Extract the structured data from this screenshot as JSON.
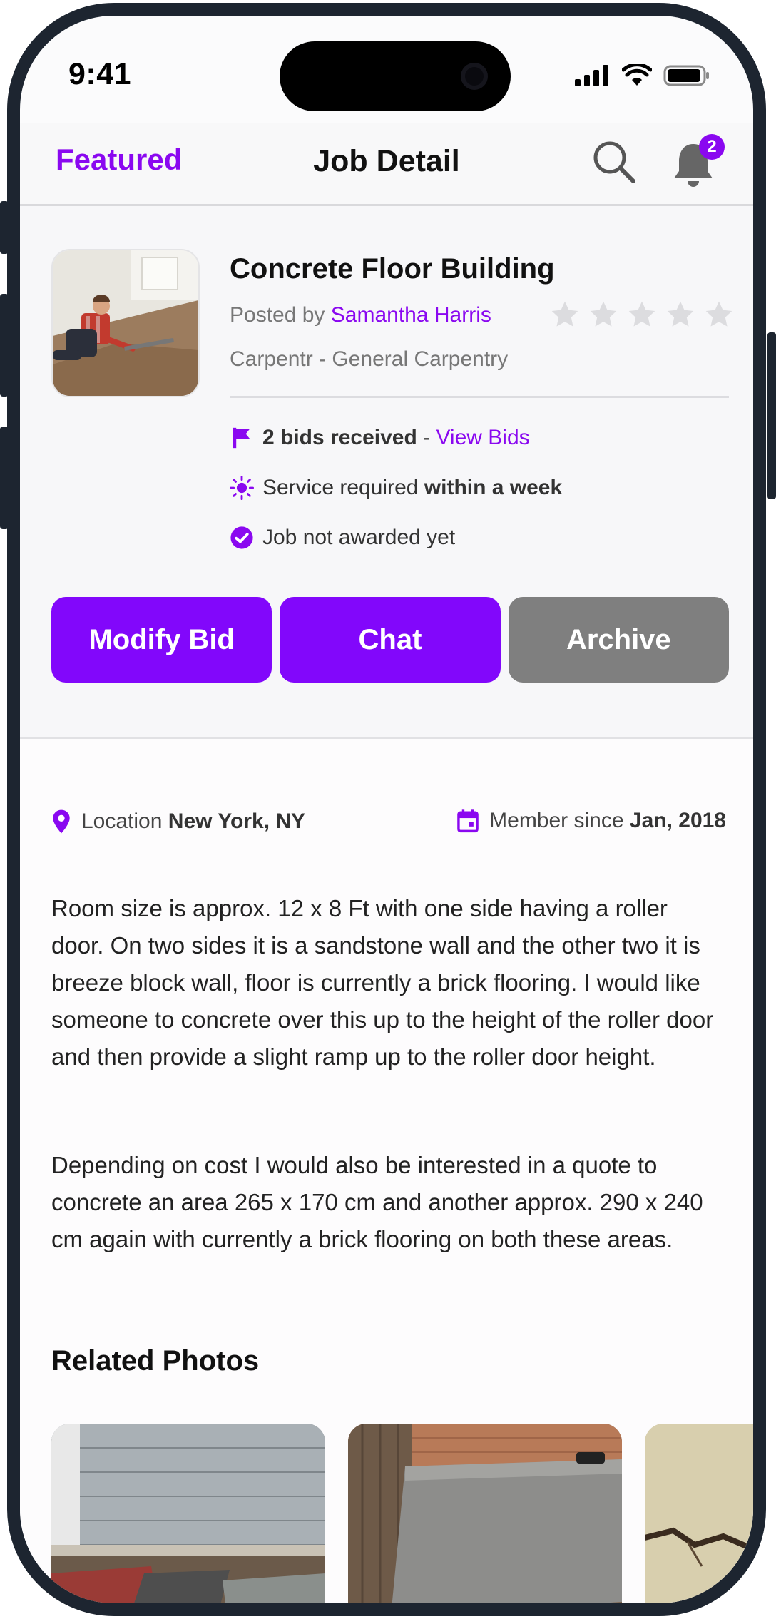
{
  "status_bar": {
    "time": "9:41"
  },
  "header": {
    "left_link": "Featured",
    "title": "Job Detail",
    "notification_count": "2"
  },
  "job": {
    "title": "Concrete Floor Building",
    "posted_prefix": "Posted by ",
    "poster": "Samantha Harris",
    "category": "Carpentr - General Carpentry",
    "rating": 0,
    "rating_max": 5,
    "bids_text": "2 bids received",
    "bids_sep": " - ",
    "view_bids": "View Bids",
    "service_prefix": "Service required ",
    "service_bold": "within a week",
    "award_status": "Job not awarded yet"
  },
  "actions": {
    "modify": "Modify Bid",
    "chat": "Chat",
    "archive": "Archive"
  },
  "meta": {
    "location_label": "Location",
    "location_value": "New York, NY",
    "member_label": "Member since",
    "member_value": "Jan, 2018"
  },
  "description": [
    "Room size is approx. 12 x 8 Ft with one side having a roller door. On two sides it is a sandstone wall and the other two it is breeze block wall, floor is currently a brick flooring. I would like someone to concrete over this up to the height of the roller door and then provide a slight ramp up to the roller door height.",
    "Depending on cost I would also be interested in a quote to concrete an area 265 x 170 cm and another approx. 290 x 240 cm again with currently a brick flooring on both these areas."
  ],
  "related": {
    "title": "Related Photos"
  },
  "colors": {
    "accent": "#8207fb",
    "archive": "#7f7f7f",
    "frame": "#1d2530"
  }
}
